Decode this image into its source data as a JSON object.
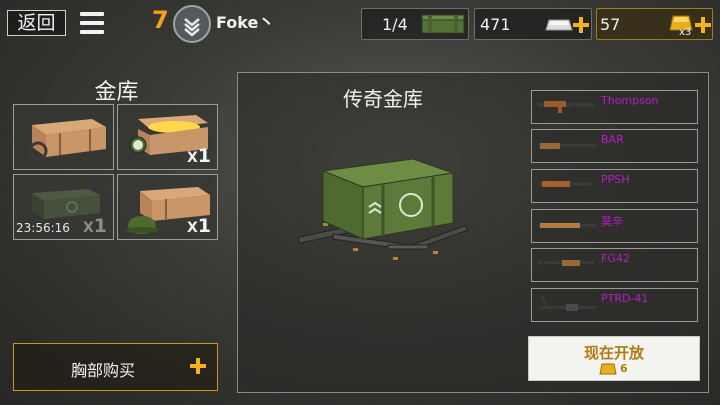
{
  "header": {
    "back_label": "返回",
    "level": "7",
    "player_name": "Foke丶",
    "crates_count": "1/4",
    "silver": "471",
    "gold": "57",
    "gold_multiplier": "x3"
  },
  "vault": {
    "title": "金库",
    "slots": [
      {
        "count": "",
        "timer": ""
      },
      {
        "count": "1",
        "timer": ""
      },
      {
        "count": "1",
        "timer": "23:56:16"
      },
      {
        "count": "1",
        "timer": ""
      }
    ],
    "buy_chest_label": "胸部购买"
  },
  "legendary": {
    "title": "传奇金库",
    "weapons": [
      "Thompson",
      "BAR",
      "PPSH",
      "莫辛",
      "FG42",
      "PTRD-41"
    ],
    "open_now_label": "现在开放",
    "open_cost": "6"
  },
  "colors": {
    "accent": "#f5b320",
    "level": "#f3a21a",
    "weapon_name": "#b21fc4",
    "crate_green": "#5d7a3a"
  }
}
